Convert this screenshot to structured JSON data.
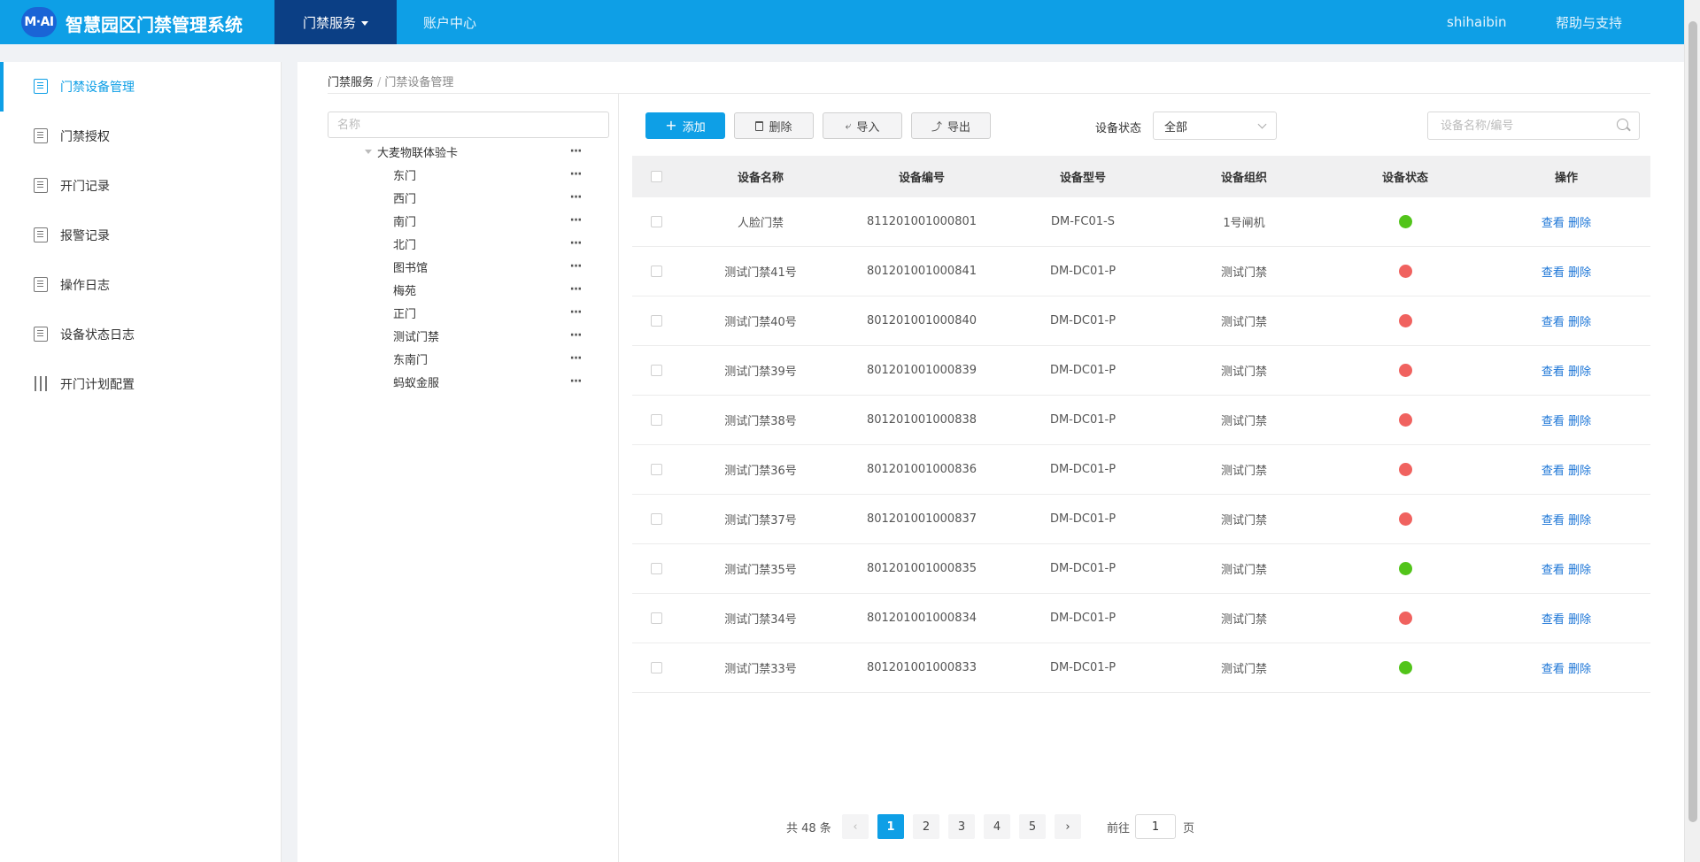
{
  "header": {
    "logo_text": "M·AI",
    "app_title": "智慧园区门禁管理系统",
    "nav_active": "门禁服务",
    "nav_account": "账户中心",
    "user": "shihaibin",
    "help": "帮助与支持",
    "colors": {
      "bar": "#0e9fe6",
      "active": "#0b3f85"
    }
  },
  "sidebar": {
    "items": [
      {
        "label": "门禁设备管理",
        "icon": "device-icon",
        "active": true
      },
      {
        "label": "门禁授权",
        "icon": "auth-icon",
        "active": false
      },
      {
        "label": "开门记录",
        "icon": "record-icon",
        "active": false
      },
      {
        "label": "报警记录",
        "icon": "alarm-icon",
        "active": false
      },
      {
        "label": "操作日志",
        "icon": "log-icon",
        "active": false
      },
      {
        "label": "设备状态日志",
        "icon": "status-log-icon",
        "active": false
      },
      {
        "label": "开门计划配置",
        "icon": "sliders-icon",
        "active": false
      }
    ]
  },
  "breadcrumb": {
    "level1": "门禁服务",
    "separator": "/",
    "level2": "门禁设备管理"
  },
  "tree": {
    "search_placeholder": "名称",
    "root": "大麦物联体验卡",
    "children": [
      "东门",
      "西门",
      "南门",
      "北门",
      "图书馆",
      "梅苑",
      "正门",
      "测试门禁",
      "东南门",
      "蚂蚁金服"
    ],
    "more": "···"
  },
  "toolbar": {
    "add": "添加",
    "add_icon": "+",
    "delete": "删除",
    "import": "导入",
    "export": "导出",
    "status_label": "设备状态",
    "status_value": "全部",
    "search_placeholder": "设备名称/编号"
  },
  "table": {
    "headers": {
      "name": "设备名称",
      "code": "设备编号",
      "model": "设备型号",
      "org": "设备组织",
      "status": "设备状态",
      "op": "操作"
    },
    "view": "查看",
    "delete": "删除",
    "status_colors": {
      "online": "#52c41a",
      "offline": "#f0625f"
    },
    "rows": [
      {
        "name": "人脸门禁",
        "code": "811201001000801",
        "model": "DM-FC01-S",
        "org": "1号闸机",
        "status": "online"
      },
      {
        "name": "测试门禁41号",
        "code": "801201001000841",
        "model": "DM-DC01-P",
        "org": "测试门禁",
        "status": "offline"
      },
      {
        "name": "测试门禁40号",
        "code": "801201001000840",
        "model": "DM-DC01-P",
        "org": "测试门禁",
        "status": "offline"
      },
      {
        "name": "测试门禁39号",
        "code": "801201001000839",
        "model": "DM-DC01-P",
        "org": "测试门禁",
        "status": "offline"
      },
      {
        "name": "测试门禁38号",
        "code": "801201001000838",
        "model": "DM-DC01-P",
        "org": "测试门禁",
        "status": "offline"
      },
      {
        "name": "测试门禁36号",
        "code": "801201001000836",
        "model": "DM-DC01-P",
        "org": "测试门禁",
        "status": "offline"
      },
      {
        "name": "测试门禁37号",
        "code": "801201001000837",
        "model": "DM-DC01-P",
        "org": "测试门禁",
        "status": "offline"
      },
      {
        "name": "测试门禁35号",
        "code": "801201001000835",
        "model": "DM-DC01-P",
        "org": "测试门禁",
        "status": "online"
      },
      {
        "name": "测试门禁34号",
        "code": "801201001000834",
        "model": "DM-DC01-P",
        "org": "测试门禁",
        "status": "offline"
      },
      {
        "name": "测试门禁33号",
        "code": "801201001000833",
        "model": "DM-DC01-P",
        "org": "测试门禁",
        "status": "online"
      }
    ]
  },
  "pagination": {
    "total": "共 48 条",
    "prev": "‹",
    "next": "›",
    "pages": [
      "1",
      "2",
      "3",
      "4",
      "5"
    ],
    "current": "1",
    "goto_label": "前往",
    "goto_value": "1",
    "unit": "页"
  }
}
